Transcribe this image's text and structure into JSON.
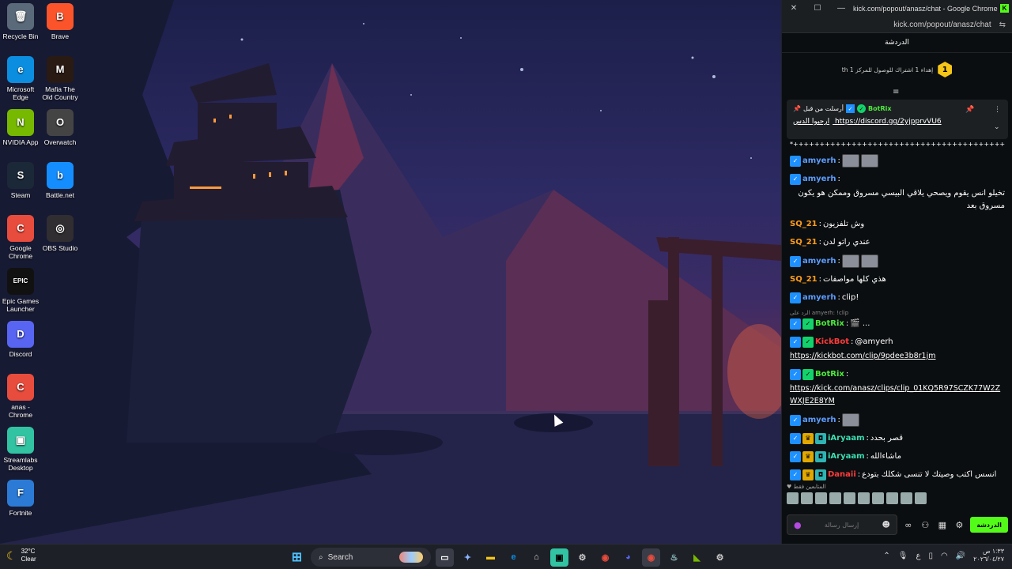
{
  "desktop": {
    "icons": [
      {
        "label": "Recycle Bin",
        "glyph": "🗑",
        "bg": "#5a6a7a"
      },
      {
        "label": "Brave",
        "glyph": "B",
        "bg": "#fb542b"
      },
      {
        "label": "Microsoft Edge",
        "glyph": "e",
        "bg": "#0c8ee0"
      },
      {
        "label": "Mafia The Old Country",
        "glyph": "M",
        "bg": "#2a1a14"
      },
      {
        "label": "NVIDIA App",
        "glyph": "N",
        "bg": "#76b900"
      },
      {
        "label": "Overwatch",
        "glyph": "O",
        "bg": "#444"
      },
      {
        "label": "Steam",
        "glyph": "S",
        "bg": "#1b2838"
      },
      {
        "label": "Battle.net",
        "glyph": "b",
        "bg": "#148eff"
      },
      {
        "label": "Google Chrome",
        "glyph": "C",
        "bg": "#e84c3d"
      },
      {
        "label": "OBS Studio",
        "glyph": "◎",
        "bg": "#302e31"
      },
      {
        "label": "Epic Games Launcher",
        "glyph": "EPIC",
        "bg": "#111"
      },
      {
        "label": "Discord",
        "glyph": "D",
        "bg": "#5865f2"
      },
      {
        "label": "anas - Chrome",
        "glyph": "C",
        "bg": "#e84c3d"
      },
      {
        "label": "Streamlabs Desktop",
        "glyph": "▣",
        "bg": "#31c3a2"
      },
      {
        "label": "Fortnite",
        "glyph": "F",
        "bg": "#2b7bd6"
      }
    ]
  },
  "chat_window": {
    "title": "kick.com/popout/anasz/chat - Google Chrome",
    "url": "kick.com/popout/anasz/chat",
    "header": "الدردشة",
    "goal_number": "1",
    "goal_text": "th إهداء 1 اشتراك للوصول للمركز 1",
    "pinned": {
      "status": "أرسلت من قبل",
      "user": "BotRix",
      "prefix": "ارحبوا الدس",
      "link": "https://discord.gg/2yjpprvVU6"
    },
    "separator": "*+++++++++++++++++++++++++++++++++++++++++++++++++*",
    "messages": [
      {
        "user": "amyerh",
        "color": "u-blue",
        "badges": [
          "verified"
        ],
        "text": "",
        "emotes": 2
      },
      {
        "user": "amyerh",
        "color": "u-blue",
        "badges": [
          "verified"
        ],
        "text": "تخيلو انس يقوم ويصحي يلاقي البيسي مسروق وممكن هو يكون مسروق بعد",
        "emotes": 0
      },
      {
        "user": "SQ_21",
        "color": "u-orange",
        "badges": [],
        "text": "وش تلفزيون",
        "emotes": 0
      },
      {
        "user": "SQ_21",
        "color": "u-orange",
        "badges": [],
        "text": "عندي راتو لدن",
        "emotes": 0
      },
      {
        "user": "amyerh",
        "color": "u-blue",
        "badges": [
          "verified"
        ],
        "text": "",
        "emotes": 2
      },
      {
        "user": "SQ_21",
        "color": "u-orange",
        "badges": [],
        "text": "هذي كلها مواصفات",
        "emotes": 0
      },
      {
        "user": "amyerh",
        "color": "u-blue",
        "badges": [
          "verified"
        ],
        "text": "!clip",
        "emotes": 0
      }
    ],
    "reply_hint": "الرد على amyerh: !clip",
    "botrix_reply": {
      "user": "BotRix",
      "text": "🎬 ..."
    },
    "kickbot": {
      "user": "KickBot",
      "mention": "@amyerh",
      "link": "https://kickbot.com/clip/9pdee3b8r1jm"
    },
    "botrix_clip": {
      "user": "BotRix",
      "link": "https://kick.com/anasz/clips/clip_01KQ5R97SCZK77W2ZWXJE2E8YM"
    },
    "late_messages": [
      {
        "user": "amyerh",
        "color": "u-blue",
        "badges": [
          "verified"
        ],
        "text": "",
        "emotes": 1
      },
      {
        "user": "iAryaam",
        "color": "u-teal",
        "badges": [
          "verified",
          "crown",
          "sub"
        ],
        "text": "قصر بحدد",
        "emotes": 0
      },
      {
        "user": "iAryaam",
        "color": "u-teal",
        "badges": [
          "verified",
          "crown",
          "sub"
        ],
        "text": "ماشاءالله",
        "emotes": 0
      },
      {
        "user": "Danaii",
        "color": "u-red",
        "badges": [
          "verified",
          "crown",
          "sub"
        ],
        "text": "انسس اكتب وصيتك لا تنسى شكلك بتودع",
        "emotes": 0
      }
    ],
    "emote_row_label": "♥ المتابعين فقط",
    "input_placeholder": "إرسال رسالة",
    "send_label": "الدردشة"
  },
  "taskbar": {
    "temp": "32°C",
    "weather": "Clear",
    "search": "Search",
    "time": "١:٣٣ ص",
    "date": "٢٠٢٦/٠٤/٢٧",
    "lang": "ع"
  }
}
